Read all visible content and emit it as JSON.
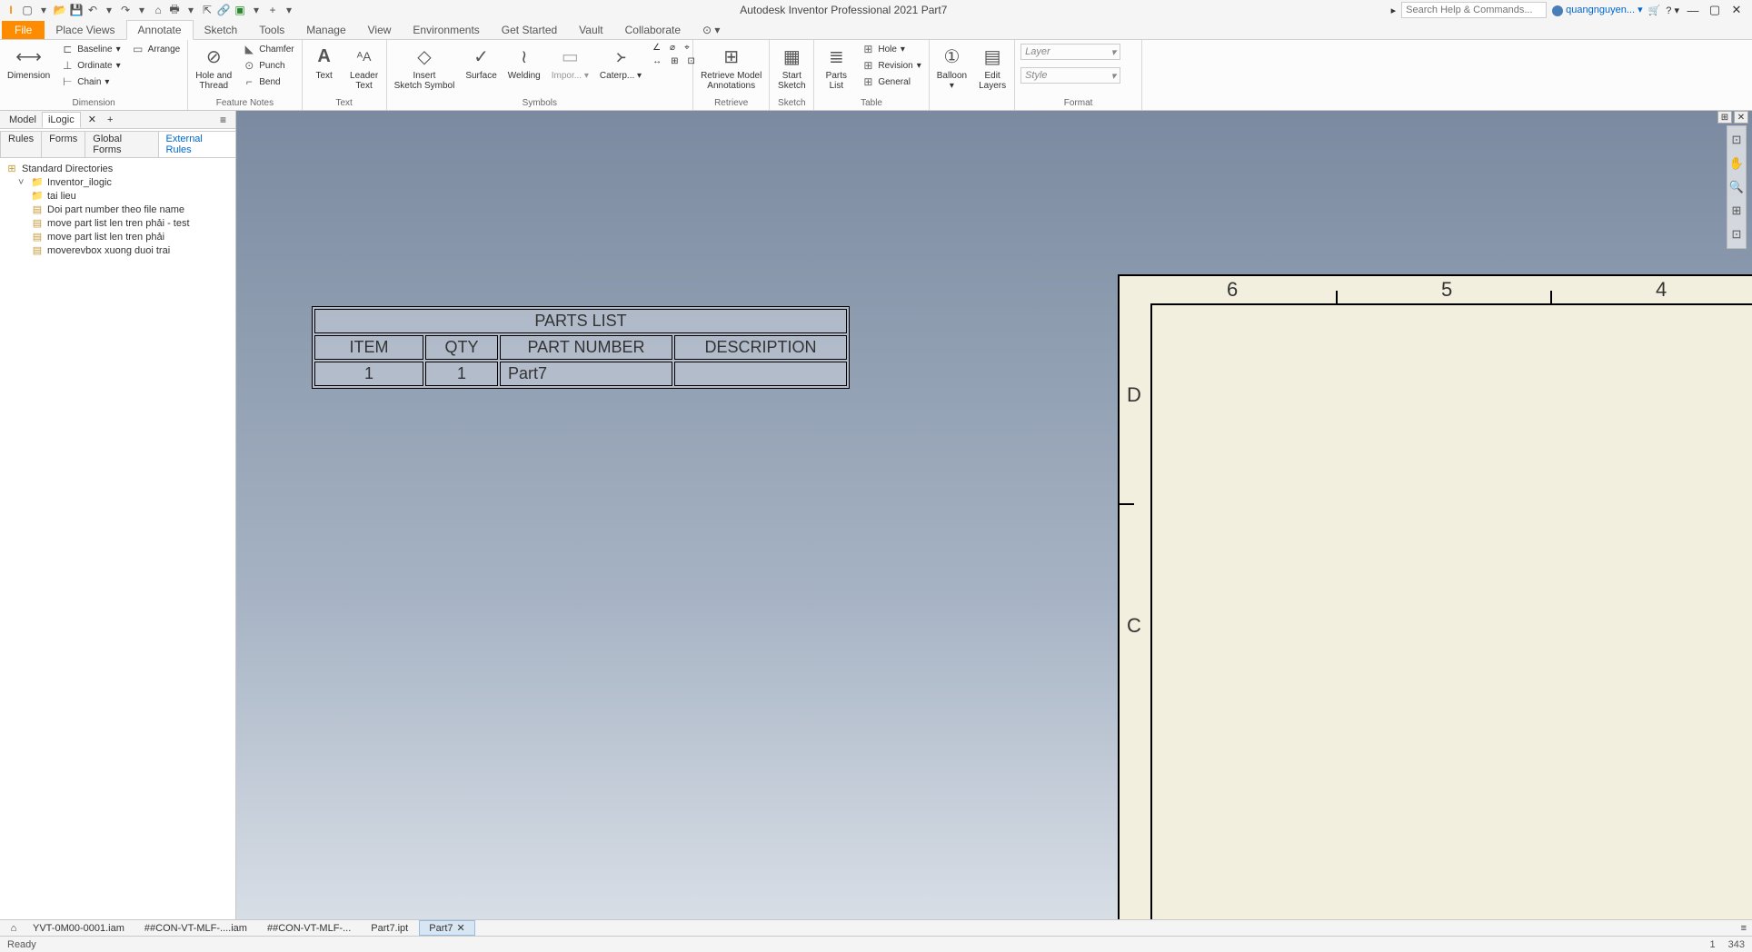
{
  "titlebar": {
    "app_title": "Autodesk Inventor Professional 2021   Part7",
    "search_placeholder": "Search Help & Commands...",
    "user": "quangnguyen...",
    "qat_icons": [
      "app-logo",
      "new-dropdown",
      "open",
      "save",
      "undo",
      "undo-dd",
      "redo",
      "redo-dd",
      "home",
      "print",
      "print-dd",
      "share",
      "link",
      "materials",
      "materials-dd",
      "plus",
      "more-dd"
    ]
  },
  "menutabs": {
    "file": "File",
    "items": [
      "Place Views",
      "Annotate",
      "Sketch",
      "Tools",
      "Manage",
      "View",
      "Environments",
      "Get Started",
      "Vault",
      "Collaborate"
    ],
    "active": "Annotate"
  },
  "ribbon": {
    "groups": [
      {
        "label": "Dimension",
        "big": [
          {
            "icon": "↔",
            "text": "Dimension"
          }
        ],
        "small": [
          [
            "⎡",
            "Baseline",
            "▾"
          ],
          [
            "⎍",
            "Ordinate",
            "▾"
          ],
          [
            "⊢",
            "Chain",
            "▾"
          ],
          [
            "▭",
            "Arrange"
          ]
        ]
      },
      {
        "label": "Feature Notes",
        "big": [
          {
            "icon": "⊘",
            "text": "Hole and\nThread"
          }
        ],
        "small": [
          [
            "⦵",
            "Chamfer"
          ],
          [
            "⊙",
            "Punch"
          ],
          [
            "⌐",
            "Bend"
          ]
        ]
      },
      {
        "label": "Text",
        "big": [
          {
            "icon": "A",
            "text": "Text"
          },
          {
            "icon": "ᴬA",
            "text": "Leader\nText"
          }
        ]
      },
      {
        "label": "Symbols",
        "big": [
          {
            "icon": "◇",
            "text": "Insert\nSketch Symbol"
          },
          {
            "icon": "✓",
            "text": "Surface"
          },
          {
            "icon": "∿",
            "text": "Welding"
          },
          {
            "icon": "▭",
            "text": "Impor...",
            "dd": true
          },
          {
            "icon": "᚛",
            "text": "Caterp...",
            "dd": true
          }
        ],
        "small_icons": [
          "∠",
          "⌀",
          "⊕",
          "↔",
          "⊞",
          "⊡"
        ]
      },
      {
        "label": "Retrieve",
        "big": [
          {
            "icon": "⊞",
            "text": "Retrieve Model\nAnnotations"
          }
        ]
      },
      {
        "label": "Sketch",
        "big": [
          {
            "icon": "▦",
            "text": "Start\nSketch"
          }
        ]
      },
      {
        "label": "Table",
        "big": [
          {
            "icon": "≡",
            "text": "Parts\nList"
          }
        ],
        "small": [
          [
            "⊞",
            "Hole",
            "▾"
          ],
          [
            "⊞",
            "Revision",
            "▾"
          ],
          [
            "⊞",
            "General"
          ]
        ]
      },
      {
        "label": "",
        "big": [
          {
            "icon": "①",
            "text": "Balloon",
            "dd": true
          },
          {
            "icon": "▤",
            "text": "Edit\nLayers"
          }
        ]
      },
      {
        "label": "Format",
        "selects": [
          "Layer",
          "Style"
        ]
      }
    ]
  },
  "sidepanel": {
    "toptabs": [
      "Model",
      "iLogic"
    ],
    "toptabs_active": "iLogic",
    "subtabs": [
      "Rules",
      "Forms",
      "Global Forms",
      "External Rules"
    ],
    "subtabs_active": "External Rules",
    "tree": {
      "root": "Standard Directories",
      "folder": "Inventor_ilogic",
      "subfolder": "tai lieu",
      "rules": [
        "Doi part number theo file name",
        "move part list len tren phải - test",
        "move part list len tren phải",
        "moverevbox xuong duoi trai"
      ]
    }
  },
  "canvas": {
    "border_numbers": [
      "6",
      "5",
      "4"
    ],
    "border_letters": [
      "D",
      "C"
    ],
    "parts_list": {
      "title": "PARTS LIST",
      "headers": [
        "ITEM",
        "QTY",
        "PART NUMBER",
        "DESCRIPTION"
      ],
      "rows": [
        [
          "1",
          "1",
          "Part7",
          ""
        ]
      ]
    }
  },
  "doctabs": {
    "items": [
      "YVT-0M00-0001.iam",
      "##CON-VT-MLF-....iam",
      "##CON-VT-MLF-...",
      "Part7.ipt",
      "Part7"
    ],
    "active": "Part7"
  },
  "statusbar": {
    "left": "Ready",
    "n1": "1",
    "n2": "343"
  }
}
